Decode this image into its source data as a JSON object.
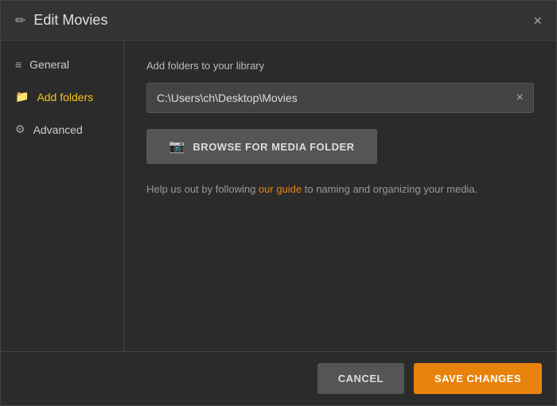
{
  "dialog": {
    "title": "Edit Movies",
    "close_label": "×"
  },
  "sidebar": {
    "items": [
      {
        "id": "general",
        "label": "General",
        "icon": "≡",
        "icon_type": "general",
        "active": false
      },
      {
        "id": "add-folders",
        "label": "Add folders",
        "icon": "📁",
        "icon_type": "folder",
        "active": true
      },
      {
        "id": "advanced",
        "label": "Advanced",
        "icon": "⚙",
        "icon_type": "gear",
        "active": false
      }
    ]
  },
  "main": {
    "section_label": "Add folders to your library",
    "folder_path": "C:\\Users\\ch\\Desktop\\Movies",
    "folder_clear_label": "×",
    "browse_button_label": "BROWSE FOR MEDIA FOLDER",
    "help_text_before": "Help us out by following ",
    "help_link_label": "our guide",
    "help_text_after": " to naming and organizing your media."
  },
  "footer": {
    "cancel_label": "CANCEL",
    "save_label": "SAVE CHANGES"
  }
}
